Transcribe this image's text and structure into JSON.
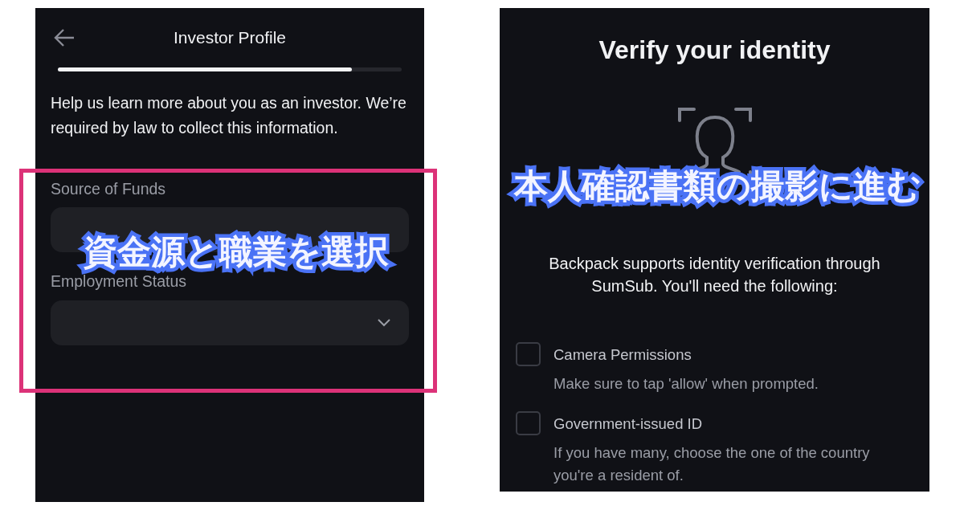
{
  "left_screen": {
    "title": "Investor Profile",
    "progress": {
      "level": 0.855
    },
    "intro": "Help us learn more about you as an investor. We’re required by law to collect this information.",
    "fields": [
      {
        "label": "Source of Funds",
        "kind": "field"
      },
      {
        "label": "Employment Status",
        "kind": "select"
      }
    ],
    "callout": "資金源と職業を選択"
  },
  "right_screen": {
    "title": "Verify your identity",
    "description": "Backpack supports identity verification through SumSub. You'll need the following:",
    "requirements": [
      {
        "title": "Camera Permissions",
        "note": "Make sure to tap 'allow' when prompted.",
        "checked": false
      },
      {
        "title": "Government-issued ID",
        "note": "If you have many, choose the one of the country you're a resident of.",
        "checked": false
      }
    ],
    "callout": "本人確認書類の撮影に進む"
  }
}
